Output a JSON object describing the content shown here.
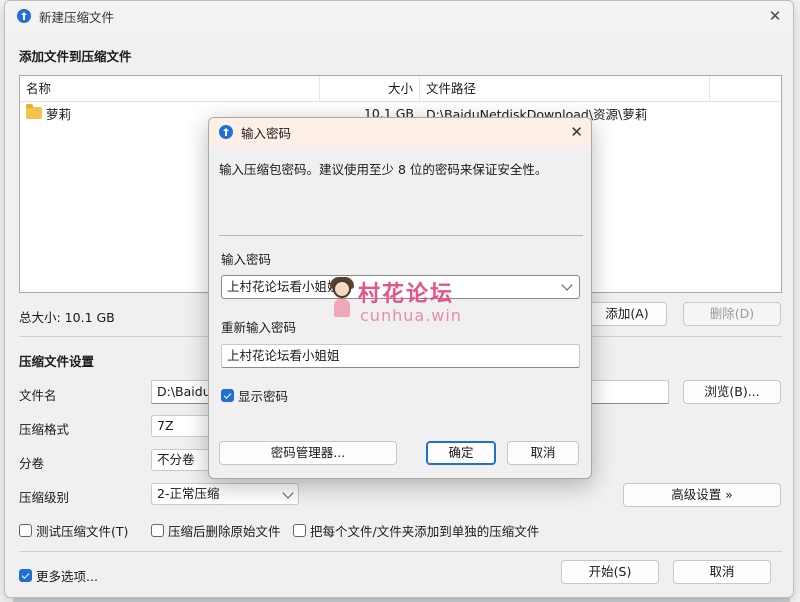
{
  "main": {
    "title": "新建压缩文件",
    "add_section": "添加文件到压缩文件",
    "columns": {
      "name": "名称",
      "size": "大小",
      "path": "文件路径"
    },
    "rows": [
      {
        "name": "萝莉",
        "size": "10.1 GB",
        "path": "D:\\BaiduNetdiskDownload\\资源\\萝莉"
      }
    ],
    "total_size": "总大小: 10.1 GB",
    "add_btn": "添加(A)",
    "delete_btn": "删除(D)",
    "settings_section": "压缩文件设置",
    "filename_label": "文件名",
    "filename_value": "D:\\BaiduN",
    "browse_btn": "浏览(B)...",
    "format_label": "压缩格式",
    "format_value": "7Z",
    "split_label": "分卷",
    "split_value": "不分卷",
    "level_label": "压缩级别",
    "level_value": "2-正常压缩",
    "advanced_btn": "高级设置 »",
    "cb_test": "测试压缩文件(T)",
    "cb_delete": "压缩后删除原始文件",
    "cb_each": "把每个文件/文件夹添加到单独的压缩文件",
    "cb_more": "更多选项...",
    "start_btn": "开始(S)",
    "cancel_btn": "取消"
  },
  "dialog": {
    "title": "输入密码",
    "description": "输入压缩包密码。建议使用至少 8 位的密码来保证安全性。",
    "password_label": "输入密码",
    "password_value": "上村花论坛看小姐姐",
    "repeat_label": "重新输入密码",
    "repeat_value": "上村花论坛看小姐姐",
    "show_password": "显示密码",
    "manager_btn": "密码管理器...",
    "ok_btn": "确定",
    "cancel_btn": "取消"
  },
  "watermark": {
    "cn": "村花论坛",
    "en": "cunhua.win"
  },
  "colors": {
    "accent": "#1f6fd6",
    "dialog_title_bg": "#fdeee6",
    "watermark": "#e7548a"
  }
}
